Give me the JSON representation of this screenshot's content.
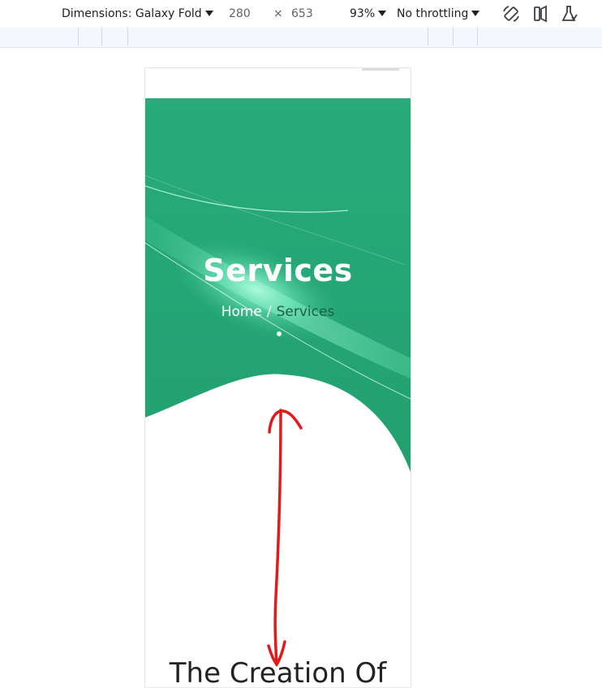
{
  "devtools": {
    "dimensions_label": "Dimensions: Galaxy Fold",
    "width_value": "280",
    "times_symbol": "×",
    "height_value": "653",
    "zoom_label": "93%",
    "throttling_label": "No throttling",
    "icons": [
      "rotate-icon",
      "device-posture-icon",
      "sensors-flask-icon"
    ]
  },
  "page": {
    "hero_title": "Services",
    "breadcrumb": {
      "home": "Home",
      "separator": "/",
      "current": "Services"
    },
    "section_title": "The Creation Of"
  },
  "colors": {
    "hero_green": "#27a978",
    "hero_highlight": "#8ff5cf",
    "annotation_red": "#e01b1b"
  }
}
